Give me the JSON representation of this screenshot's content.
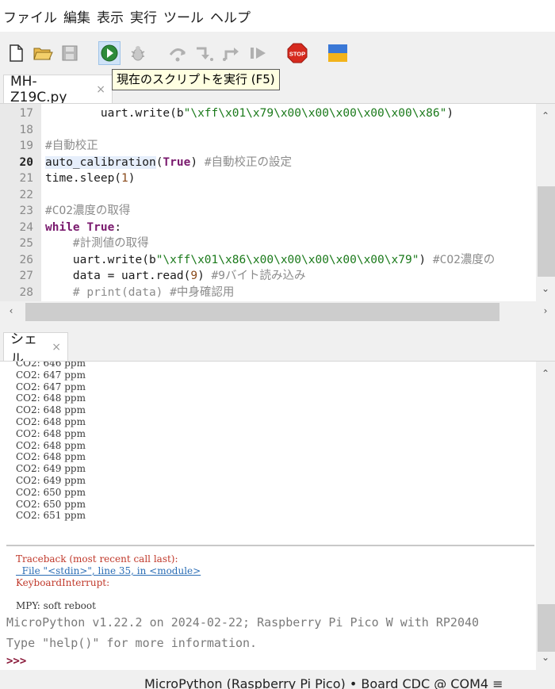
{
  "menu": [
    "ファイル",
    "編集",
    "表示",
    "実行",
    "ツール",
    "ヘルプ"
  ],
  "tooltip": "現在のスクリプトを実行 (F5)",
  "editor": {
    "tab_label": "MH-Z19C.py",
    "close_glyph": "×",
    "current_line": 20,
    "lines": [
      {
        "num": "17",
        "indent": "        ",
        "parts": [
          [
            "uart.write(b",
            ""
          ],
          [
            "\"\\xff\\x01\\x79\\x00\\x00\\x00\\x00\\x00\\x86\"",
            "str"
          ],
          [
            ")",
            ""
          ]
        ]
      },
      {
        "num": "18",
        "indent": "",
        "parts": []
      },
      {
        "num": "19",
        "indent": "",
        "parts": [
          [
            "#自動校正",
            "cmt"
          ]
        ]
      },
      {
        "num": "20",
        "indent": "",
        "parts": [
          [
            "auto_calibration",
            "hl"
          ],
          [
            "(",
            ""
          ],
          [
            "True",
            "kw"
          ],
          [
            ") ",
            ""
          ],
          [
            "#自動校正の設定",
            "cmt"
          ]
        ]
      },
      {
        "num": "21",
        "indent": "",
        "parts": [
          [
            "time.sleep(",
            ""
          ],
          [
            "1",
            "num"
          ],
          [
            ")",
            ""
          ]
        ]
      },
      {
        "num": "22",
        "indent": "",
        "parts": []
      },
      {
        "num": "23",
        "indent": "",
        "parts": [
          [
            "#CO2濃度の取得",
            "cmt"
          ]
        ]
      },
      {
        "num": "24",
        "indent": "",
        "parts": [
          [
            "while",
            "kw"
          ],
          [
            " ",
            ""
          ],
          [
            "True",
            "kw"
          ],
          [
            ":",
            ""
          ]
        ]
      },
      {
        "num": "25",
        "indent": "    ",
        "parts": [
          [
            "#計測値の取得",
            "cmt"
          ]
        ]
      },
      {
        "num": "26",
        "indent": "    ",
        "parts": [
          [
            "uart.write(b",
            ""
          ],
          [
            "\"\\xff\\x01\\x86\\x00\\x00\\x00\\x00\\x00\\x79\"",
            "str"
          ],
          [
            ") ",
            ""
          ],
          [
            "#CO2濃度の",
            "cmt"
          ]
        ]
      },
      {
        "num": "27",
        "indent": "    ",
        "parts": [
          [
            "data = uart.read(",
            ""
          ],
          [
            "9",
            "num"
          ],
          [
            ") ",
            ""
          ],
          [
            "#9バイト読み込み",
            "cmt"
          ]
        ]
      },
      {
        "num": "28",
        "indent": "    ",
        "parts": [
          [
            "# print(data) #中身確認用",
            "cmt"
          ]
        ]
      }
    ]
  },
  "shell": {
    "tab_label": "シェル",
    "close_glyph": "×",
    "output": [
      "CO2: 646 ppm",
      "CO2: 647 ppm",
      "CO2: 647 ppm",
      "CO2: 648 ppm",
      "CO2: 648 ppm",
      "CO2: 648 ppm",
      "CO2: 648 ppm",
      "CO2: 648 ppm",
      "CO2: 648 ppm",
      "CO2: 649 ppm",
      "CO2: 649 ppm",
      "CO2: 650 ppm",
      "CO2: 650 ppm",
      "CO2: 651 ppm"
    ],
    "traceback": "Traceback (most recent call last):",
    "file_line": "  File \"<stdin>\", line 35, in <module>",
    "error": "KeyboardInterrupt:",
    "reboot": "MPY: soft reboot",
    "banner_1": "MicroPython v1.22.2 on 2024-02-22; Raspberry Pi Pico W with RP2040",
    "banner_2": "Type \"help()\" for more information.",
    "prompt": ">>>"
  },
  "status": {
    "text": "MicroPython (Raspberry Pi Pico)  •  Board CDC @ COM4  ≡"
  },
  "colors": {
    "string": "#1b7a1b",
    "comment": "#8c8c8c",
    "keyword": "#7a1a6e",
    "error": "#c0392b",
    "link": "#2a6db5"
  },
  "icons": {
    "toolbar": [
      "new-file-icon",
      "open-folder-icon",
      "save-icon",
      "run-icon",
      "debug-icon",
      "step-over-icon",
      "step-into-icon",
      "step-out-icon",
      "resume-icon",
      "stop-icon",
      "zoom-icon"
    ]
  }
}
